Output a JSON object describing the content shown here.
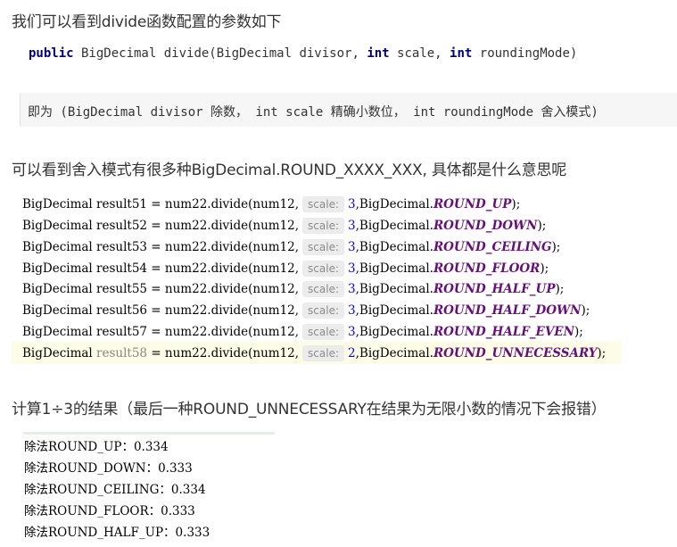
{
  "heading1": "我们可以看到divide函数配置的参数如下",
  "signature": {
    "kw_public": "public",
    "part1": " BigDecimal divide(BigDecimal divisor, ",
    "kw_int1": "int",
    "part2": " scale, ",
    "kw_int2": "int",
    "part3": " roundingMode)"
  },
  "note": "即为 (BigDecimal divisor 除数， int scale 精确小数位，  int roundingMode 舍入模式)",
  "heading2": "可以看到舍入模式有很多种BigDecimal.ROUND_XXXX_XXX, 具体都是什么意思呢",
  "code_lines": [
    {
      "prefix": "BigDecimal result51 = num22.divide(num12,",
      "hint": "scale:",
      "num": "3",
      "mid": ",BigDecimal.",
      "const": "ROUND_UP",
      "suffix": ");"
    },
    {
      "prefix": "BigDecimal result52 = num22.divide(num12,",
      "hint": "scale:",
      "num": "3",
      "mid": ",BigDecimal.",
      "const": "ROUND_DOWN",
      "suffix": ");"
    },
    {
      "prefix": "BigDecimal result53 = num22.divide(num12,",
      "hint": "scale:",
      "num": "3",
      "mid": ",BigDecimal.",
      "const": "ROUND_CEILING",
      "suffix": ");"
    },
    {
      "prefix": "BigDecimal result54 = num22.divide(num12,",
      "hint": "scale:",
      "num": "3",
      "mid": ",BigDecimal.",
      "const": "ROUND_FLOOR",
      "suffix": ");"
    },
    {
      "prefix": "BigDecimal result55 = num22.divide(num12,",
      "hint": "scale:",
      "num": "3",
      "mid": ",BigDecimal.",
      "const": "ROUND_HALF_UP",
      "suffix": ");"
    },
    {
      "prefix": "BigDecimal result56 = num22.divide(num12,",
      "hint": "scale:",
      "num": "3",
      "mid": ",BigDecimal.",
      "const": "ROUND_HALF_DOWN",
      "suffix": ");"
    },
    {
      "prefix": "BigDecimal result57 = num22.divide(num12,",
      "hint": "scale:",
      "num": "3",
      "mid": ",BigDecimal.",
      "const": "ROUND_HALF_EVEN",
      "suffix": ");"
    }
  ],
  "code_line_last": {
    "p1": "BigDecimal ",
    "var": "result58",
    "p2": " = num22.divide(num12,",
    "hint": "scale:",
    "num": "2",
    "mid": ",BigDecimal.",
    "const": "ROUND_UNNECESSARY",
    "suffix": ");"
  },
  "heading3": "计算1÷3的结果（最后一种ROUND_UNNECESSARY在结果为无限小数的情况下会报错）",
  "output_lines": [
    "除法ROUND_UP：0.334",
    "除法ROUND_DOWN：0.333",
    "除法ROUND_CEILING：0.334",
    "除法ROUND_FLOOR：0.333",
    "除法ROUND_HALF_UP：0.333"
  ],
  "colors": {
    "keyword": "#000080",
    "number": "#0000ff",
    "constant": "#660e7a",
    "highlight": "#fdfce6"
  }
}
